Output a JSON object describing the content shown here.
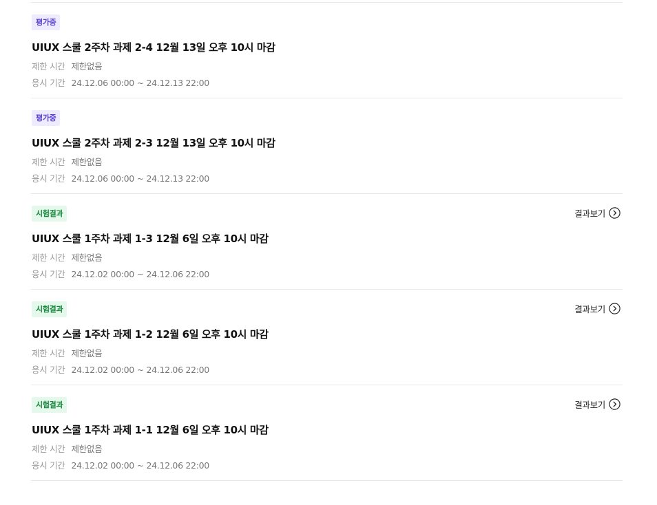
{
  "labels": {
    "limit_key": "제한 시간",
    "period_key": "응시 기간",
    "result_link": "결과보기"
  },
  "items": [
    {
      "status": "평가중",
      "status_type": "eval",
      "title": "UIUX 스쿨 2주차 과제 2-4 12월 13일 오후 10시 마감",
      "limit": "제한없음",
      "period": "24.12.06 00:00 ~ 24.12.13 22:00",
      "has_result": false
    },
    {
      "status": "평가중",
      "status_type": "eval",
      "title": "UIUX 스쿨 2주차 과제 2-3 12월 13일 오후 10시 마감",
      "limit": "제한없음",
      "period": "24.12.06 00:00 ~ 24.12.13 22:00",
      "has_result": false
    },
    {
      "status": "시험결과",
      "status_type": "result",
      "title": "UIUX 스쿨 1주차 과제 1-3 12월 6일 오후 10시 마감",
      "limit": "제한없음",
      "period": "24.12.02 00:00 ~ 24.12.06 22:00",
      "has_result": true
    },
    {
      "status": "시험결과",
      "status_type": "result",
      "title": "UIUX 스쿨 1주차 과제 1-2 12월 6일 오후 10시 마감",
      "limit": "제한없음",
      "period": "24.12.02 00:00 ~ 24.12.06 22:00",
      "has_result": true
    },
    {
      "status": "시험결과",
      "status_type": "result",
      "title": "UIUX 스쿨 1주차 과제 1-1 12월 6일 오후 10시 마감",
      "limit": "제한없음",
      "period": "24.12.02 00:00 ~ 24.12.06 22:00",
      "has_result": true
    }
  ],
  "colors": {
    "eval_badge_bg": "#eeebff",
    "eval_badge_text": "#5b42d6",
    "result_badge_bg": "#e5f8ec",
    "result_badge_text": "#17893d"
  },
  "icons": {
    "result_link_icon": "chevron-right-circle-icon"
  }
}
